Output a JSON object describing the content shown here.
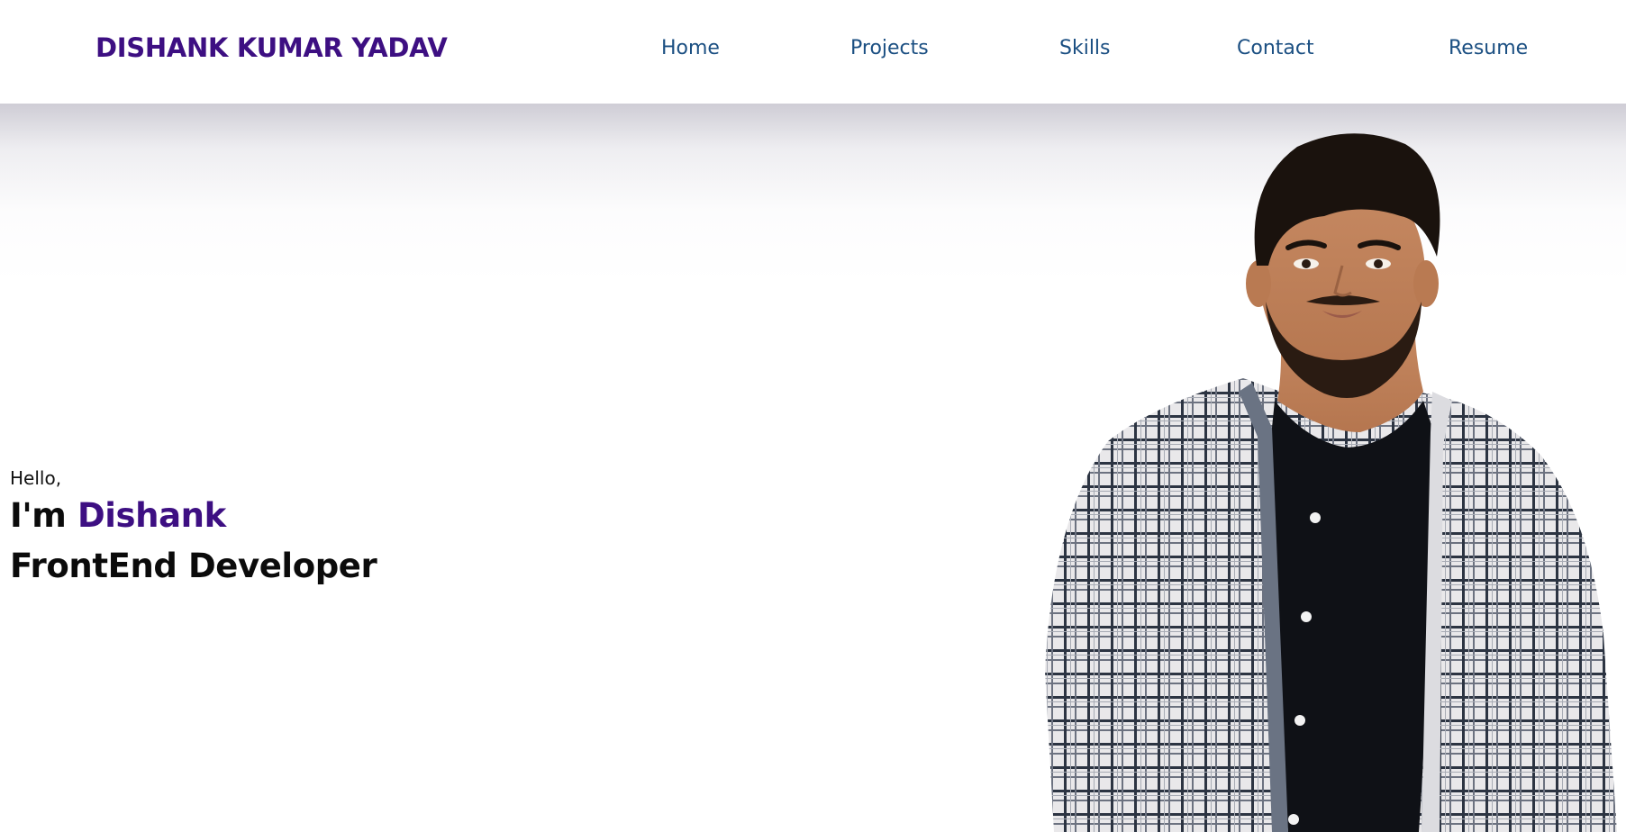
{
  "header": {
    "brand": "DISHANK KUMAR YADAV",
    "nav": {
      "home": "Home",
      "projects": "Projects",
      "skills": "Skills",
      "contact": "Contact",
      "resume": "Resume"
    }
  },
  "hero": {
    "greeting": "Hello,",
    "intro_prefix": "I'm ",
    "name": "Dishank",
    "role": "FrontEnd Developer"
  },
  "colors": {
    "brand": "#3d0f82",
    "nav_link": "#1b4f82",
    "text": "#0b0b0b",
    "background": "#ffffff"
  },
  "icons": {
    "portrait": "profile-photo"
  }
}
